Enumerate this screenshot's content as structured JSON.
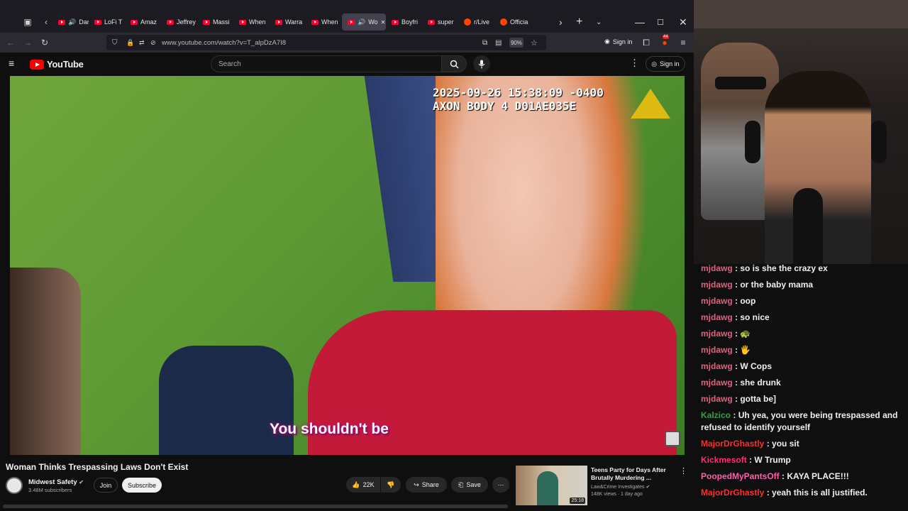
{
  "browser": {
    "tabs": [
      {
        "label": "Dark S",
        "icon": "youtube-favicon",
        "audio": true
      },
      {
        "label": "LoFi T",
        "icon": "youtube-favicon"
      },
      {
        "label": "Amaz",
        "icon": "youtube-favicon"
      },
      {
        "label": "Jeffrey",
        "icon": "youtube-favicon"
      },
      {
        "label": "Massi",
        "icon": "youtube-favicon"
      },
      {
        "label": "When",
        "icon": "youtube-favicon"
      },
      {
        "label": "Warra",
        "icon": "youtube-favicon"
      },
      {
        "label": "When",
        "icon": "youtube-favicon"
      },
      {
        "label": "Wo",
        "icon": "youtube-favicon",
        "audio": true,
        "active": true
      },
      {
        "label": "Boyfri",
        "icon": "youtube-favicon"
      },
      {
        "label": "super",
        "icon": "youtube-favicon"
      },
      {
        "label": "r/Live",
        "icon": "reddit-favicon"
      },
      {
        "label": "Officia",
        "icon": "reddit-favicon"
      }
    ],
    "url": "www.youtube.com/watch?v=T_alpDzA7I8",
    "zoom": "90%",
    "signin_label": "Sign in",
    "notif_count": "44"
  },
  "youtube": {
    "logo_text": "YouTube",
    "search_placeholder": "Search",
    "signin_label": "Sign in",
    "video": {
      "timestamp_line1": "2025-09-26 15:38:09 -0400",
      "timestamp_line2": "AXON BODY 4 D01AE035E",
      "subtitle": "You shouldn't be"
    },
    "title": "Woman Thinks Trespassing Laws Don't Exist",
    "channel": {
      "name": "Midwest Safety",
      "subscribers": "3.48M subscribers"
    },
    "join_label": "Join",
    "subscribe_label": "Subscribe",
    "likes": "22K",
    "share_label": "Share",
    "save_label": "Save",
    "recommended": {
      "title": "Teens Party for Days After Brutally Murdering ...",
      "channel": "Law&Crime Investigates",
      "views": "148K views · 1 day ago",
      "duration": "25:18"
    }
  },
  "chat": {
    "messages": [
      {
        "user": "mjdawg",
        "text": "so is she the crazy ex",
        "color": "#e0607e"
      },
      {
        "user": "mjdawg",
        "text": "or the baby mama",
        "color": "#e0607e"
      },
      {
        "user": "mjdawg",
        "text": "oop",
        "color": "#e0607e"
      },
      {
        "user": "mjdawg",
        "text": "so nice",
        "color": "#e0607e"
      },
      {
        "user": "mjdawg",
        "text": "🐢",
        "color": "#e0607e"
      },
      {
        "user": "mjdawg",
        "text": "🖐",
        "color": "#e0607e"
      },
      {
        "user": "mjdawg",
        "text": "W Cops",
        "color": "#e0607e"
      },
      {
        "user": "mjdawg",
        "text": "she drunk",
        "color": "#e0607e"
      },
      {
        "user": "mjdawg",
        "text": "gotta be]",
        "color": "#e0607e"
      },
      {
        "user": "Kalzico",
        "text": "Uh yea, you were being trespassed and refused to identify yourself",
        "color": "#2ea043"
      },
      {
        "user": "MajorDrGhastly",
        "text": "you sit",
        "color": "#ff2d2d"
      },
      {
        "user": "Kickmesoft",
        "text": "W Trump",
        "color": "#ff2d6e"
      },
      {
        "user": "PoopedMyPantsOff",
        "text": "KAYA PLACE!!!",
        "color": "#ff5fa8"
      },
      {
        "user": "MajorDrGhastly",
        "text": "yeah this is all justified.",
        "color": "#ff2d2d"
      }
    ]
  }
}
